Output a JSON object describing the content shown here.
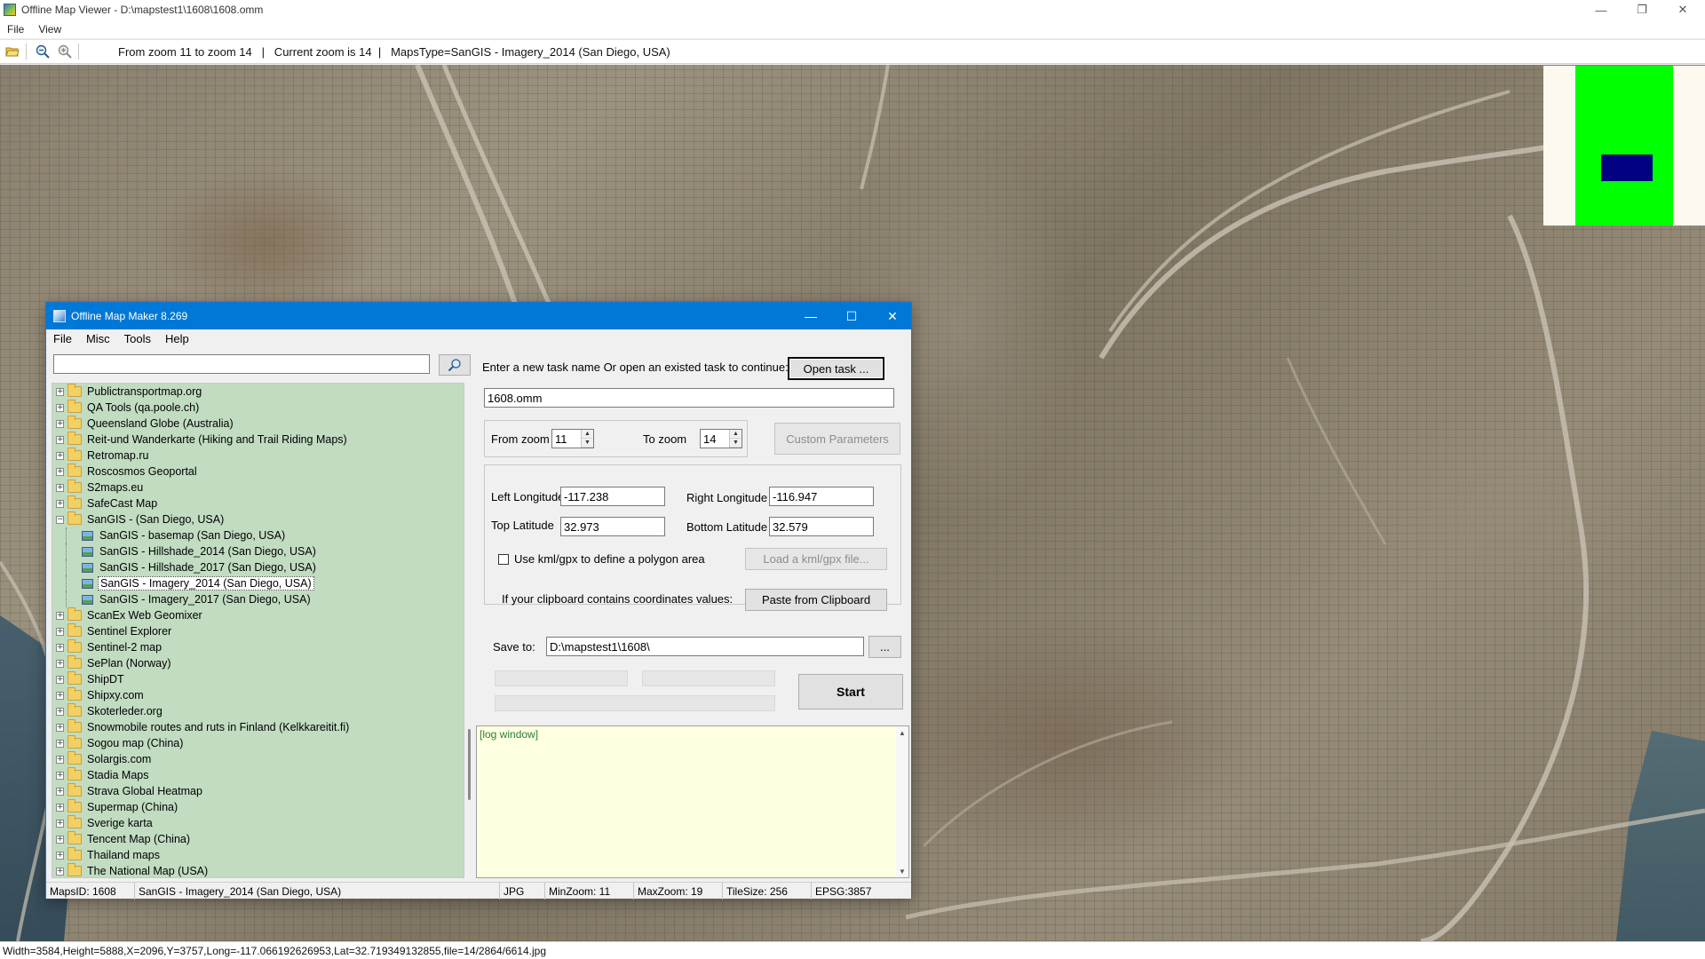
{
  "main_window": {
    "title": "Offline Map Viewer - D:\\mapstest1\\1608\\1608.omm",
    "menu": [
      "File",
      "View"
    ],
    "toolbar_info": "From zoom 11 to zoom 14   |   Current zoom is 14  |   MapsType=SanGIS - Imagery_2014 (San Diego, USA)",
    "status": "Width=3584,Height=5888,X=2096,Y=3757,Long=-117.066192626953,Lat=32.719349132855,file=14/2864/6614.jpg"
  },
  "dialog": {
    "title": "Offline Map Maker 8.269",
    "menu": [
      "File",
      "Misc",
      "Tools",
      "Help"
    ],
    "search": {
      "value": ""
    },
    "tree": [
      {
        "label": "Publictransportmap.org",
        "type": "folder"
      },
      {
        "label": "QA Tools (qa.poole.ch)",
        "type": "folder"
      },
      {
        "label": "Queensland Globe (Australia)",
        "type": "folder"
      },
      {
        "label": "Reit-und Wanderkarte (Hiking and Trail Riding Maps)",
        "type": "folder"
      },
      {
        "label": "Retromap.ru",
        "type": "folder"
      },
      {
        "label": "Roscosmos Geoportal",
        "type": "folder"
      },
      {
        "label": "S2maps.eu",
        "type": "folder"
      },
      {
        "label": "SafeCast Map",
        "type": "folder"
      },
      {
        "label": "SanGIS - (San Diego, USA)",
        "type": "folder-open"
      },
      {
        "label": "SanGIS - basemap (San Diego, USA)",
        "type": "map"
      },
      {
        "label": "SanGIS - Hillshade_2014 (San Diego, USA)",
        "type": "map"
      },
      {
        "label": "SanGIS - Hillshade_2017 (San Diego, USA)",
        "type": "map"
      },
      {
        "label": "SanGIS - Imagery_2014 (San Diego, USA)",
        "type": "map-selected"
      },
      {
        "label": "SanGIS - Imagery_2017 (San Diego, USA)",
        "type": "map"
      },
      {
        "label": "ScanEx Web Geomixer",
        "type": "folder"
      },
      {
        "label": "Sentinel Explorer",
        "type": "folder"
      },
      {
        "label": "Sentinel-2 map",
        "type": "folder"
      },
      {
        "label": "SePlan (Norway)",
        "type": "folder"
      },
      {
        "label": "ShipDT",
        "type": "folder"
      },
      {
        "label": "Shipxy.com",
        "type": "folder"
      },
      {
        "label": "Skoterleder.org",
        "type": "folder"
      },
      {
        "label": "Snowmobile routes and ruts in Finland (Kelkkareitit.fi)",
        "type": "folder"
      },
      {
        "label": "Sogou map (China)",
        "type": "folder"
      },
      {
        "label": "Solargis.com",
        "type": "folder"
      },
      {
        "label": "Stadia Maps",
        "type": "folder"
      },
      {
        "label": "Strava Global Heatmap",
        "type": "folder"
      },
      {
        "label": "Supermap (China)",
        "type": "folder"
      },
      {
        "label": "Sverige karta",
        "type": "folder"
      },
      {
        "label": "Tencent Map (China)",
        "type": "folder"
      },
      {
        "label": "Thailand maps",
        "type": "folder"
      },
      {
        "label": "The National Map (USA)",
        "type": "folder"
      }
    ],
    "task_prompt": "Enter a new task name Or open an existed task to continue:",
    "open_task_label": "Open task ...",
    "task_name": "1608.omm",
    "from_zoom_label": "From zoom",
    "from_zoom": "11",
    "to_zoom_label": "To zoom",
    "to_zoom": "14",
    "custom_params_label": "Custom Parameters",
    "left_lon_label": "Left Longitude",
    "left_lon": "-117.238",
    "right_lon_label": "Right Longitude",
    "right_lon": "-116.947",
    "top_lat_label": "Top Latitude",
    "top_lat": "32.973",
    "bottom_lat_label": "Bottom Latitude",
    "bottom_lat": "32.579",
    "kml_label": "Use kml/gpx to define a polygon area",
    "load_kml_label": "Load a kml/gpx file...",
    "clipboard_prompt": "If your clipboard contains coordinates values:",
    "paste_label": "Paste from Clipboard",
    "save_to_label": "Save to:",
    "save_to": "D:\\mapstest1\\1608\\",
    "browse_label": "...",
    "start_label": "Start",
    "log_text": "[log window]",
    "status": {
      "maps_id": "MapsID: 1608",
      "map_name": "SanGIS - Imagery_2014 (San Diego, USA)",
      "format": "JPG",
      "min_zoom": "MinZoom: 11",
      "max_zoom": "MaxZoom: 19",
      "tile_size": "TileSize: 256",
      "epsg": "EPSG:3857"
    }
  },
  "colors": {
    "dialog_title": "#0078d7",
    "tree_bg": "#c1dcc1",
    "log_bg": "#ffffe1",
    "overview_green": "#00ff00",
    "overview_navy": "#000080"
  }
}
